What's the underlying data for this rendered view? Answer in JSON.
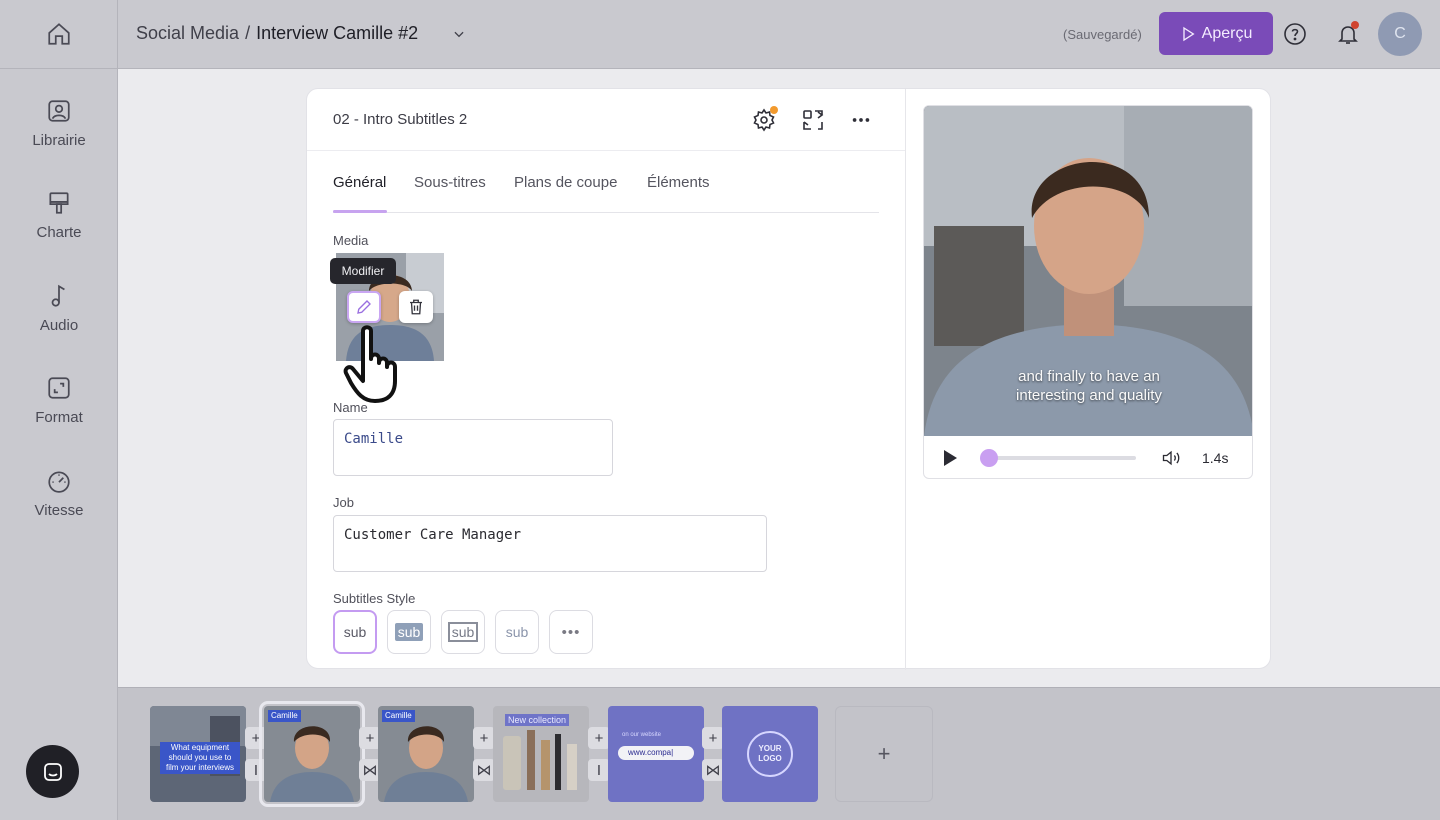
{
  "sidebar": {
    "home_icon": "home-icon",
    "items": [
      {
        "label": "Librairie",
        "icon": "image-icon"
      },
      {
        "label": "Charte",
        "icon": "paint-roller-icon"
      },
      {
        "label": "Audio",
        "icon": "music-note-icon"
      },
      {
        "label": "Format",
        "icon": "crop-icon"
      },
      {
        "label": "Vitesse",
        "icon": "speedometer-icon"
      }
    ],
    "chat_icon": "chat-icon"
  },
  "topbar": {
    "breadcrumb_parent": "Social Media",
    "breadcrumb_sep": "/",
    "breadcrumb_current": "Interview Camille #2",
    "save_status": "(Sauvegardé)",
    "preview_button": "Aperçu",
    "avatar_initial": "C"
  },
  "editor": {
    "title": "02 - Intro Subtitles 2",
    "tabs": [
      {
        "label": "Général",
        "active": true
      },
      {
        "label": "Sous-titres",
        "active": false
      },
      {
        "label": "Plans de coupe",
        "active": false
      },
      {
        "label": "Éléments",
        "active": false
      }
    ],
    "media_label": "Media",
    "tooltip": "Modifier",
    "name_label": "Name",
    "name_value": "Camille",
    "job_label": "Job",
    "job_value": "Customer Care Manager",
    "subtitles_style_label": "Subtitles Style",
    "style_options": [
      "sub",
      "sub",
      "sub",
      "sub",
      "•••"
    ]
  },
  "preview": {
    "subtitle_line1": "and finally to have an",
    "subtitle_line2": "interesting and quality",
    "time": "1.4s",
    "progress_fraction": 0.02
  },
  "timeline": {
    "clip1_caption": "What equipment should you use to film your interviews",
    "clip2_caption": "Camille",
    "clip3_caption": "Camille",
    "clip4_label": "New collection",
    "clip5_hint": "on our website",
    "clip5_url": "www.compa|",
    "clip6_logo": "YOUR LOGO",
    "add_label": "+",
    "connector_plus": "+",
    "connector_cut": "I",
    "connector_transition": "⋈"
  },
  "colors": {
    "accent": "#7a4bb8",
    "accent_light": "#c99ff1",
    "notification_dot": "#d0442f",
    "settings_dot": "#f29a2e"
  }
}
